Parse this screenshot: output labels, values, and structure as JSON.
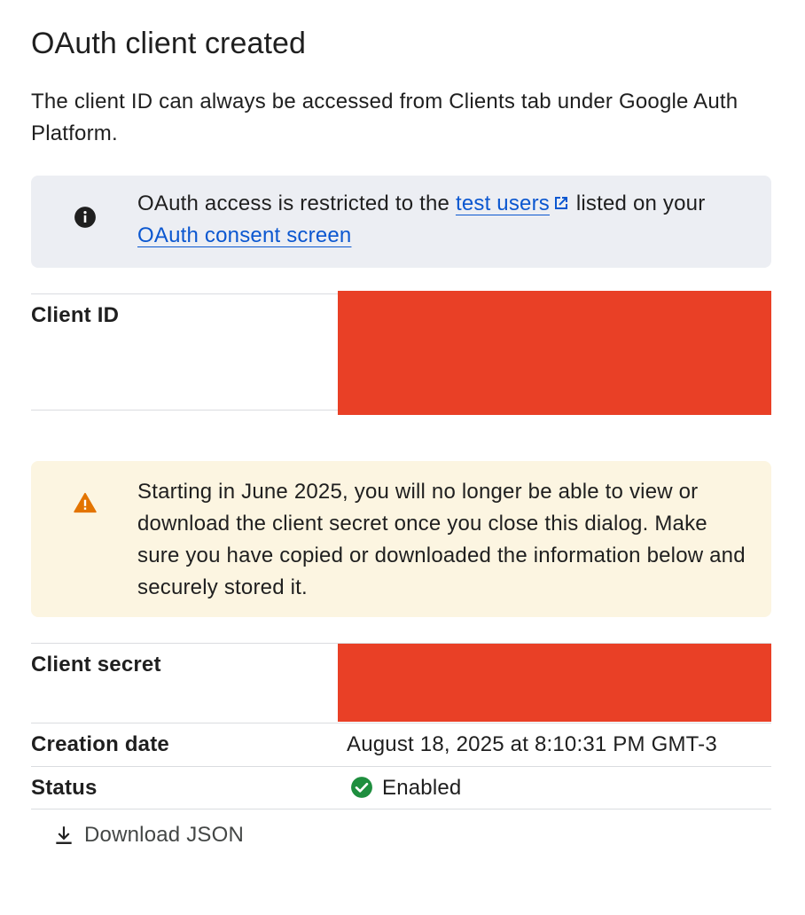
{
  "dialog": {
    "title": "OAuth client created",
    "intro": "The client ID can always be accessed from Clients tab under Google Auth Platform."
  },
  "info_banner": {
    "icon": "info-icon",
    "text_before": "OAuth access is restricted to the ",
    "link_test_users": "test users",
    "text_middle": " listed on your ",
    "link_consent": "OAuth consent screen",
    "link_icon": "external-link-icon"
  },
  "client_id": {
    "label": "Client ID"
  },
  "warning_banner": {
    "icon": "warning-icon",
    "text": "Starting in June 2025, you will no longer be able to view or download the client secret once you close this dialog. Make sure you have copied or downloaded the information below and securely stored it."
  },
  "client_secret": {
    "label": "Client secret"
  },
  "creation_date": {
    "label": "Creation date",
    "value": "August 18, 2025 at 8:10:31 PM GMT-3"
  },
  "status": {
    "label": "Status",
    "value": "Enabled",
    "icon": "check-circle-icon"
  },
  "download": {
    "label": "Download JSON",
    "icon": "download-icon"
  },
  "colors": {
    "link": "#0b57d0",
    "info_bg": "#eceef3",
    "warn_bg": "#fcf5e1",
    "warn_icon": "#e37400",
    "success": "#1e8e3e",
    "redaction": "#e94026"
  }
}
